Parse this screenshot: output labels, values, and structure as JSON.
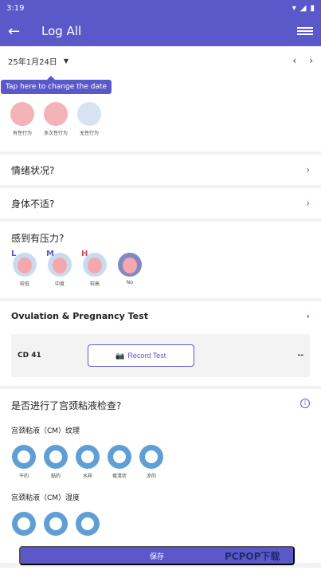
{
  "status": {
    "time": "3:19"
  },
  "appbar": {
    "title": "Log All"
  },
  "date": {
    "value": "25年1月24日"
  },
  "tooltip": {
    "text": "Tap here to change the date"
  },
  "sex": {
    "items": [
      {
        "label": "有性行为",
        "color": "#c94a56"
      },
      {
        "label": "多次性行为",
        "color": "#c94a56"
      },
      {
        "label": "无性行为",
        "color": "#7f89c4"
      }
    ]
  },
  "mood": {
    "label": "情绪状况?"
  },
  "body": {
    "label": "身体不适?"
  },
  "stress": {
    "title": "感到有压力?",
    "items": [
      {
        "letter": "L",
        "label": "较低"
      },
      {
        "letter": "M",
        "label": "中度"
      },
      {
        "letter": "H",
        "label": "较高"
      },
      {
        "letter": "",
        "label": "No"
      }
    ]
  },
  "ovulation": {
    "title": "Ovulation & Pregnancy Test",
    "cd": "CD 41",
    "button": "Record Test",
    "value": "--"
  },
  "cervical": {
    "title": "是否进行了宫颈粘液检查?",
    "texture_label": "宫颈粘液（CM）纹理",
    "moisture_label": "宫颈粘液（CM）湿度",
    "texture_items": [
      "干的",
      "黏的",
      "水样",
      "蛋清状",
      "凉的"
    ]
  },
  "save": {
    "label": "保存"
  },
  "watermark": {
    "text": "PCPOP下载"
  }
}
